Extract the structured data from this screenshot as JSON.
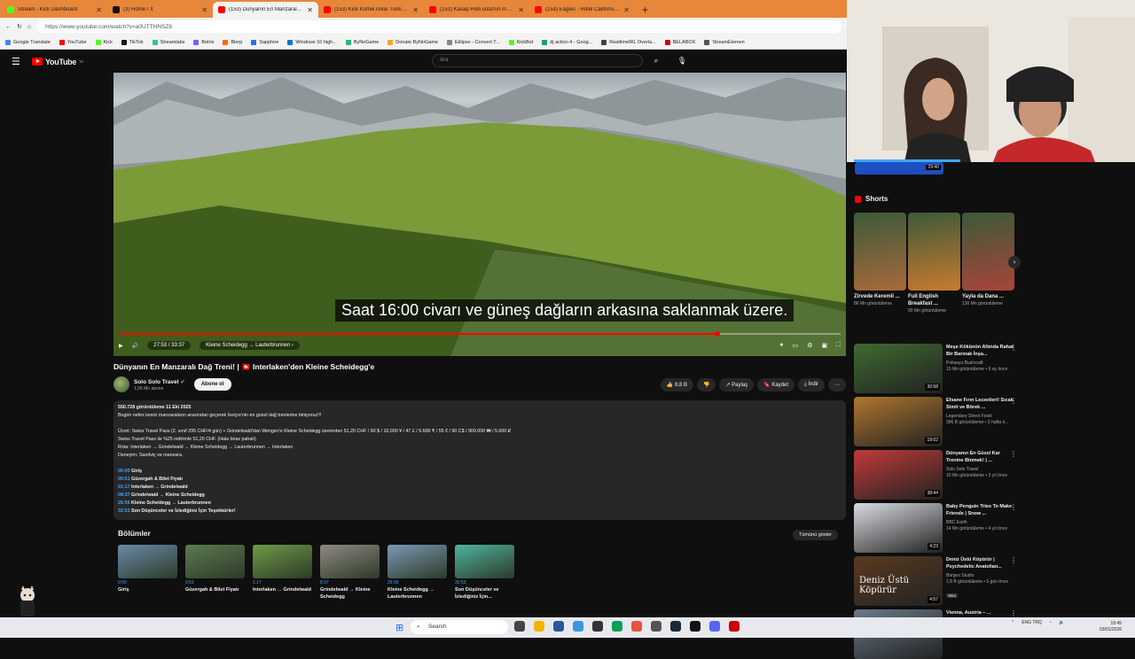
{
  "browser": {
    "tabs": [
      {
        "label": "Stream - Kick Dashboard",
        "color": "#53fc18",
        "active": false
      },
      {
        "label": "(3) Home / X",
        "color": "#111111",
        "active": false
      },
      {
        "label": "(153) Dünyanın En Manzaralı Dağ",
        "color": "#ff0000",
        "active": true
      },
      {
        "label": "(153) Kick Komik Anlar Türkiye Re",
        "color": "#ff0000",
        "active": false
      },
      {
        "label": "(153) Kasap Holli usta'nın meşhur",
        "color": "#ff0000",
        "active": false
      },
      {
        "label": "(153) Eagles - Hotel California (Liv",
        "color": "#ff0000",
        "active": false
      }
    ],
    "new_tab": "+",
    "url": "https://www.youtube.com/watch?v=a0UTTHNSZ8",
    "bookmarks": [
      "Google Translate",
      "YouTube",
      "Kick",
      "TikTok",
      "Streamlabs",
      "Botrix",
      "Blerp",
      "Sapphire",
      "Windows 10 high...",
      "ByNoGame",
      "Donate ByNoGame",
      "Eklipse - Convert T...",
      "KickBot",
      "dj action 4 - Goog...",
      "RealtimeIRL Overla...",
      "BELABOX",
      "StreamElemen"
    ]
  },
  "youtube": {
    "logo": "YouTube",
    "logo_sup": "TR",
    "search_placeholder": "Ara"
  },
  "player": {
    "caption": "Saat 16:00 civarı ve güneş dağların arkasına saklanmak üzere.",
    "time": "27:53 / 33:37",
    "chapter": "Kleine Scheidegg → Lauterbrunnen ›",
    "progress": 0.829
  },
  "video": {
    "title": "Dünyanın En Manzaralı Dağ Treni! | 🇨🇭 Interlaken'den Kleine Scheidegg'e",
    "channel": "Solo Solo Travel",
    "subscribers": "1,56 Mn abone",
    "subscribe": "Abone ol",
    "likes": "8,8 B",
    "share": "Paylaş",
    "save": "Kaydet",
    "download": "İndir"
  },
  "description": {
    "stats": "550.728 görüntüleme  11 Eki 2025",
    "lines": [
      "Bugün nefes kesici manzaraların arasından geçerek İsviçre'nin en güzel dağ trenlerine biniyoruz!!!",
      "",
      "Ücret: Swiss Travel Pass (2. sınıf 295 CHF/4 gün) + Grindelwald'dan Wengen'e Kleine Scheidegg üzerinden 51,20 CHF / 60 $ / 10.000 ¥ / 47 £ / 5.600 ₹ / 55 € / 90 C$ / 900.000 ₩ / 5.000 ₽",
      "Swiss Travel Pass ile %25 indirimle 51,20 CHF. (Hala biraz pahalı)",
      "Rota: Interlaken → Grindelwald → Kleine Scheidegg → Lauterbrunnen → Interlaken",
      "Deneyim: Sandviç ve manzara.",
      ""
    ],
    "timestamps": [
      {
        "t": "00:00",
        "label": "Giriş"
      },
      {
        "t": "00:51",
        "label": "Güzergah & Bilet Fiyatı"
      },
      {
        "t": "01:17",
        "label": "Interlaken → Grindelwald"
      },
      {
        "t": "08:37",
        "label": "Grindelwald → Kleine Scheidegg"
      },
      {
        "t": "26:56",
        "label": "Kleine Scheidegg → Lauterbrunnen"
      },
      {
        "t": "32:53",
        "label": "Son Düşünceler ve İzlediğiniz İçin Teşekkürler!"
      }
    ]
  },
  "chapters": {
    "heading": "Bölümler",
    "show_all": "Tümünü göster",
    "items": [
      {
        "time": "0:00",
        "title": "Giriş",
        "color": "#6a8aa8"
      },
      {
        "time": "0:51",
        "title": "Güzergah & Bilet Fiyatı",
        "color": "#5d7a52"
      },
      {
        "time": "1:17",
        "title": "Interlaken → Grindelwald",
        "color": "#6f9a48"
      },
      {
        "time": "8:37",
        "title": "Grindelwald → Kleine Scheidegg",
        "color": "#8f8a82"
      },
      {
        "time": "26:56",
        "title": "Kleine Scheidegg → Lauterbrunnen",
        "color": "#7c98b6"
      },
      {
        "time": "32:53",
        "title": "Son Düşünceler ve İzlediğiniz İçin...",
        "color": "#4fb3a0"
      }
    ]
  },
  "sidebar": {
    "cam_time": "29:40",
    "shorts_heading": "Shorts",
    "shorts": [
      {
        "title": "Zirvede Keremli ...",
        "views": "86 Mn görüntüleme",
        "color": "#a86a3a"
      },
      {
        "title": "Full English Breakfast ...",
        "views": "90 Mn görüntüleme",
        "color": "#c97a2e"
      },
      {
        "title": "Yayla da Dana ...",
        "views": "130 Mn görüntüleme",
        "color": "#a8443a"
      }
    ],
    "recs": [
      {
        "title": "Meşe Kökünün Altında Rahat Bir Barınak İnşa...",
        "channel": "Poltasya Bushcraft",
        "views": "10 Mn görüntüleme • 6 ay önce",
        "duration": "30:58",
        "color": "#3f6a30"
      },
      {
        "title": "Efsane Fırın Lezzetleri! Sıcak Simit ve Börek ...",
        "channel": "Legendary Street Food",
        "views": "396 B görüntüleme • 3 hafta ö...",
        "duration": "19:02",
        "color": "#b0772e"
      },
      {
        "title": "Dünyanın En Güzel Kar Trenine Binmek! | ...",
        "channel": "Solo Solo Travel",
        "views": "10 Mn görüntüleme • 2 yıl önce",
        "duration": "38:44",
        "color": "#c23a3a"
      },
      {
        "title": "Baby Penguin Tries To Make Friends | Snow ...",
        "channel": "BBC Earth",
        "views": "14 Mn görüntüleme • 4 yıl önce",
        "duration": "4:23",
        "color": "#d9dde2"
      },
      {
        "title": "Deniz Üstü Köpürür | Psychedelic Anatolian...",
        "channel": "Borges Studio",
        "views": "1,8 B görüntüleme • 5 gün önce",
        "duration": "4:57",
        "badge": "Yeni",
        "overlay": "Deniz Üstü Köpürür",
        "color": "#5a3a20"
      },
      {
        "title": "Vienna, Austria – ...",
        "channel": "",
        "views": "",
        "duration": "",
        "color": "#6a7a8a"
      }
    ]
  },
  "taskbar": {
    "search": "Search",
    "lang": "ENG TRQ",
    "time": "19:45",
    "date": "03/01/2026"
  }
}
